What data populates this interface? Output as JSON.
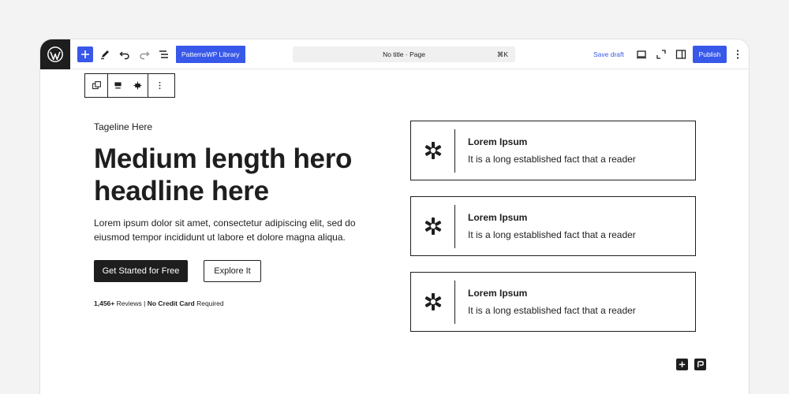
{
  "toolbar": {
    "library_label": "PatternsWP Library",
    "doc_title": "No title · Page",
    "shortcut": "⌘K",
    "save_draft_label": "Save draft",
    "publish_label": "Publish"
  },
  "hero": {
    "tagline": "Tageline Here",
    "headline": "Medium length hero headline here",
    "description": "Lorem ipsum dolor sit amet, consectetur adipiscing elit, sed do eiusmod tempor incididunt ut labore et dolore magna aliqua.",
    "primary_button": "Get Started for Free",
    "secondary_button": "Explore It",
    "reviews_count": "1,456+",
    "reviews_word": "Reviews",
    "separator": "|",
    "no_cc": "No Credit Card",
    "required": "Required"
  },
  "cards": [
    {
      "title": "Lorem Ipsum",
      "text": "It is a long established fact that a reader"
    },
    {
      "title": "Lorem Ipsum",
      "text": "It is a long established fact that a reader"
    },
    {
      "title": "Lorem Ipsum",
      "text": "It is a long established fact that a reader"
    }
  ],
  "colors": {
    "accent": "#3858e9",
    "dark": "#1e1e1e",
    "background": "#f3f3f3"
  }
}
